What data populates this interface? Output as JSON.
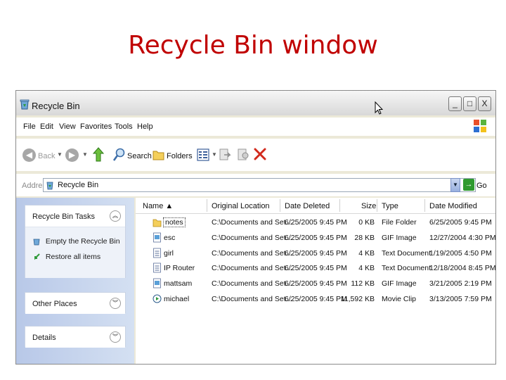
{
  "slide": {
    "title": "Recycle Bin window"
  },
  "window": {
    "title": "Recycle Bin",
    "controls": {
      "minimize": "_",
      "maximize": "□",
      "close": "X"
    }
  },
  "menu": [
    "File",
    "Edit",
    "View",
    "Favorites",
    "Tools",
    "Help"
  ],
  "toolbar": {
    "back": "Back",
    "search": "Search",
    "folders": "Folders"
  },
  "address": {
    "label": "Address",
    "value": "Recycle Bin",
    "go": "Go"
  },
  "tasks_panel": {
    "title": "Recycle Bin Tasks",
    "items": [
      "Empty the Recycle Bin",
      "Restore all items"
    ]
  },
  "other_places": {
    "title": "Other Places"
  },
  "details": {
    "title": "Details"
  },
  "columns": {
    "name": "Name ▲",
    "original_location": "Original Location",
    "date_deleted": "Date Deleted",
    "size": "Size",
    "type": "Type",
    "date_modified": "Date Modified"
  },
  "files": [
    {
      "name": "notes",
      "location": "C:\\Documents and Set...",
      "deleted": "6/25/2005 9:45 PM",
      "size": "0 KB",
      "type": "File Folder",
      "modified": "6/25/2005 9:45 PM",
      "icon": "folder-icon"
    },
    {
      "name": "esc",
      "location": "C:\\Documents and Set...",
      "deleted": "6/25/2005 9:45 PM",
      "size": "28 KB",
      "type": "GIF Image",
      "modified": "12/27/2004 4:30 PM",
      "icon": "gif-image-icon"
    },
    {
      "name": "girl",
      "location": "C:\\Documents and Set...",
      "deleted": "6/25/2005 9:45 PM",
      "size": "4 KB",
      "type": "Text Document",
      "modified": "1/19/2005 4:50 PM",
      "icon": "text-document-icon"
    },
    {
      "name": "IP Router",
      "location": "C:\\Documents and Set...",
      "deleted": "6/25/2005 9:45 PM",
      "size": "4 KB",
      "type": "Text Document",
      "modified": "12/18/2004 8:45 PM",
      "icon": "text-document-icon"
    },
    {
      "name": "mattsam",
      "location": "C:\\Documents and Set...",
      "deleted": "6/25/2005 9:45 PM",
      "size": "112 KB",
      "type": "GIF Image",
      "modified": "3/21/2005 2:19 PM",
      "icon": "gif-image-icon"
    },
    {
      "name": "michael",
      "location": "C:\\Documents and Set...",
      "deleted": "6/25/2005 9:45 PM",
      "size": "11,592 KB",
      "type": "Movie Clip",
      "modified": "3/13/2005 7:59 PM",
      "icon": "movie-clip-icon"
    }
  ]
}
